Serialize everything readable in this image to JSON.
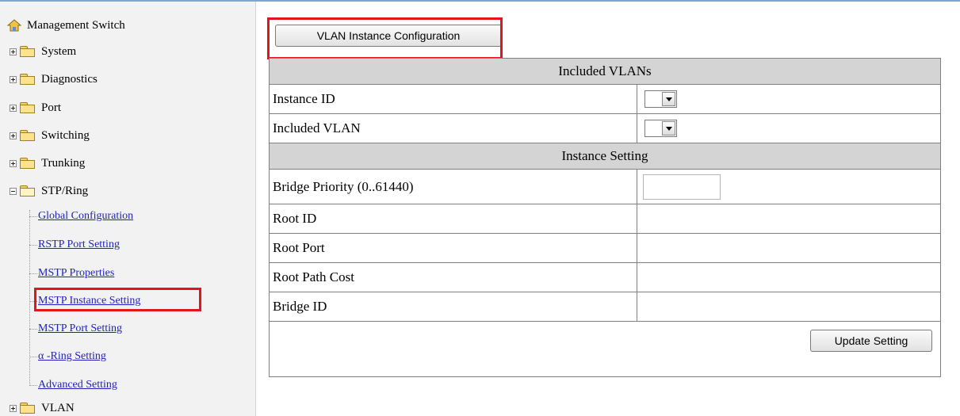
{
  "sidebar": {
    "root_label": "Management Switch",
    "folders": [
      {
        "label": "System",
        "expanded": false
      },
      {
        "label": "Diagnostics",
        "expanded": false
      },
      {
        "label": "Port",
        "expanded": false
      },
      {
        "label": "Switching",
        "expanded": false
      },
      {
        "label": "Trunking",
        "expanded": false
      },
      {
        "label": "STP/Ring",
        "expanded": true
      },
      {
        "label": "VLAN",
        "expanded": false
      }
    ],
    "stp_children": [
      "Global Configuration",
      "RSTP Port Setting",
      "MSTP Properties",
      "MSTP Instance Setting",
      "MSTP Port Setting",
      "α -Ring Setting",
      "Advanced Setting"
    ]
  },
  "main": {
    "config_button": "VLAN Instance Configuration",
    "section_included": "Included VLANs",
    "instance_id_label": "Instance ID",
    "instance_id_value": "",
    "included_vlan_label": "Included VLAN",
    "included_vlan_value": "",
    "section_instance": "Instance Setting",
    "bridge_priority_label": "Bridge Priority (0..61440)",
    "bridge_priority_value": "",
    "root_id_label": "Root ID",
    "root_id_value": "",
    "root_port_label": "Root Port",
    "root_port_value": "",
    "root_path_cost_label": "Root Path Cost",
    "root_path_cost_value": "",
    "bridge_id_label": "Bridge ID",
    "bridge_id_value": "",
    "update_button": "Update Setting"
  },
  "colors": {
    "highlight": "#e3141a",
    "header_bg": "#d4d4d4",
    "link": "#1f1fbf"
  }
}
